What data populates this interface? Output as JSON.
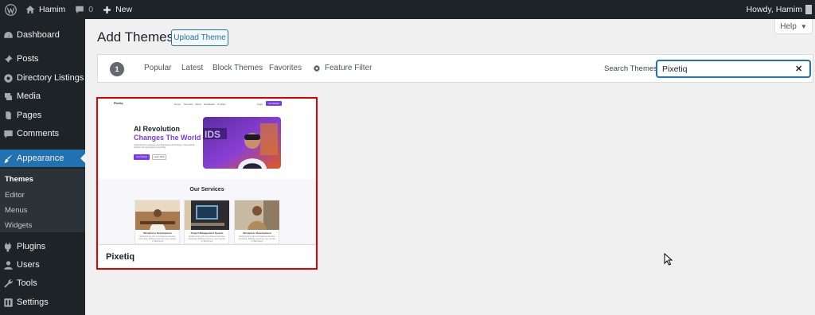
{
  "admin_bar": {
    "site_name": "Hamim",
    "comment_count": "0",
    "new_label": "New",
    "howdy": "Howdy, Hamim"
  },
  "sidebar": {
    "items": [
      {
        "label": "Dashboard",
        "icon": "dashboard-icon"
      },
      {
        "label": "Posts",
        "icon": "pin-icon"
      },
      {
        "label": "Directory Listings",
        "icon": "listings-icon"
      },
      {
        "label": "Media",
        "icon": "media-icon"
      },
      {
        "label": "Pages",
        "icon": "pages-icon"
      },
      {
        "label": "Comments",
        "icon": "comments-icon"
      },
      {
        "label": "Appearance",
        "icon": "brush-icon"
      },
      {
        "label": "Plugins",
        "icon": "plugin-icon"
      },
      {
        "label": "Users",
        "icon": "users-icon"
      },
      {
        "label": "Tools",
        "icon": "wrench-icon"
      },
      {
        "label": "Settings",
        "icon": "settings-icon"
      }
    ],
    "submenu": [
      "Themes",
      "Editor",
      "Menus",
      "Widgets"
    ]
  },
  "header": {
    "title": "Add Themes",
    "upload_button": "Upload Theme",
    "help_label": "Help"
  },
  "filter_bar": {
    "count": "1",
    "links": [
      "Popular",
      "Latest",
      "Block Themes",
      "Favorites"
    ],
    "feature_filter": "Feature Filter",
    "search_label": "Search Themes",
    "search_value": "Pixetiq"
  },
  "theme": {
    "name": "Pixetiq",
    "preview": {
      "logo": "Pixetiq",
      "nav": [
        "Home",
        "Services",
        "About",
        "Newsletter",
        "Contact"
      ],
      "login": "Login",
      "cta": "Get Started",
      "headline_1": "AI Revolution",
      "headline_2": "Changes The World",
      "body": "Unlimited AI to enhance your Businesses technology, enterprise AI solutions for automating everything.",
      "btn_primary": "Get Started",
      "btn_secondary": "Learn More",
      "services_title": "Our Services",
      "services": [
        {
          "title": "Wordpress Development",
          "text": "Building future with personalized automation technology. Building experience user interface for Bloomberg"
        },
        {
          "title": "Project Management System",
          "text": "Building future with personalized automation technology. Building experience user interface for Bloomberg"
        },
        {
          "title": "Wordpress Development",
          "text": "Building future with personalized automation technology. Building experience user interface for Bloomberg"
        }
      ]
    }
  },
  "colors": {
    "admin_dark": "#1d2327",
    "accent": "#2271b1",
    "highlight_border": "#e00000",
    "preview_purple": "#7c3aed"
  }
}
